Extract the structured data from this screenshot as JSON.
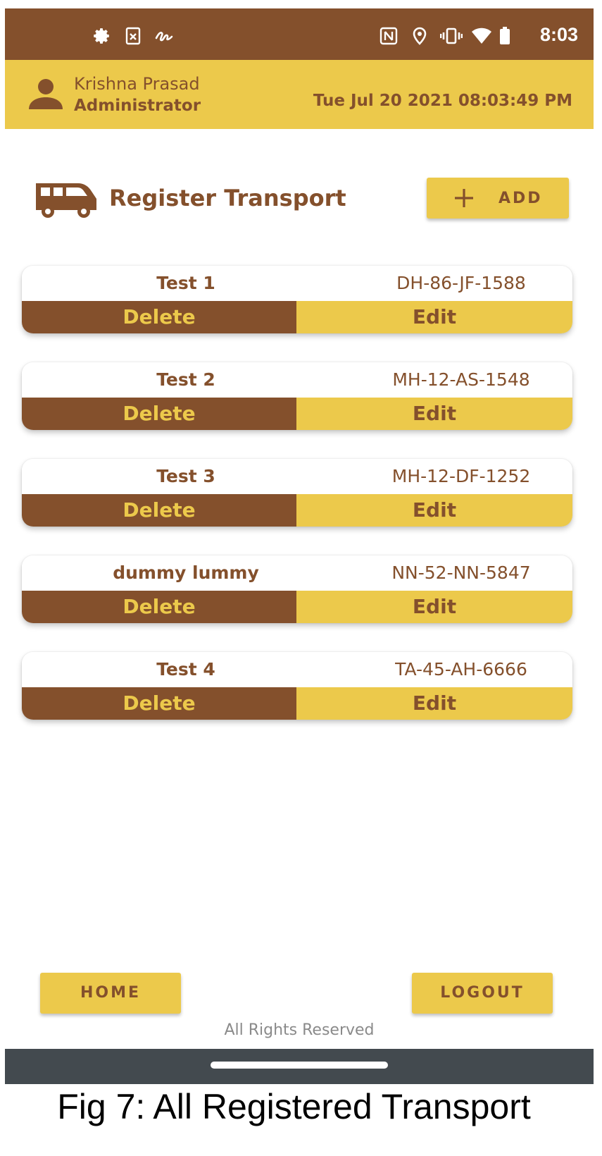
{
  "status_bar": {
    "time": "8:03",
    "left_icons": [
      "gear-icon",
      "sim-off-icon",
      "signature-icon"
    ],
    "right_icons": [
      "nfc-icon",
      "location-icon",
      "vibrate-icon",
      "wifi-icon",
      "battery-icon"
    ]
  },
  "header": {
    "user_name": "Krishna Prasad",
    "user_role": "Administrator",
    "datetime": "Tue Jul 20 2021 08:03:49 PM"
  },
  "page": {
    "title": "Register Transport",
    "add_label": "ADD"
  },
  "transports": [
    {
      "name": "Test 1",
      "plate": "DH-86-JF-1588",
      "delete_label": "Delete",
      "edit_label": "Edit"
    },
    {
      "name": "Test 2",
      "plate": "MH-12-AS-1548",
      "delete_label": "Delete",
      "edit_label": "Edit"
    },
    {
      "name": "Test 3",
      "plate": "MH-12-DF-1252",
      "delete_label": "Delete",
      "edit_label": "Edit"
    },
    {
      "name": "dummy lummy",
      "plate": "NN-52-NN-5847",
      "delete_label": "Delete",
      "edit_label": "Edit"
    },
    {
      "name": "Test 4",
      "plate": "TA-45-AH-6666",
      "delete_label": "Delete",
      "edit_label": "Edit"
    }
  ],
  "footer": {
    "home_label": "HOME",
    "logout_label": "LOGOUT",
    "copyright": "All Rights Reserved"
  },
  "caption": "Fig 7: All Registered Transport",
  "colors": {
    "brown": "#84502c",
    "yellow": "#ecc94b",
    "nav_bar": "#434a4f"
  }
}
